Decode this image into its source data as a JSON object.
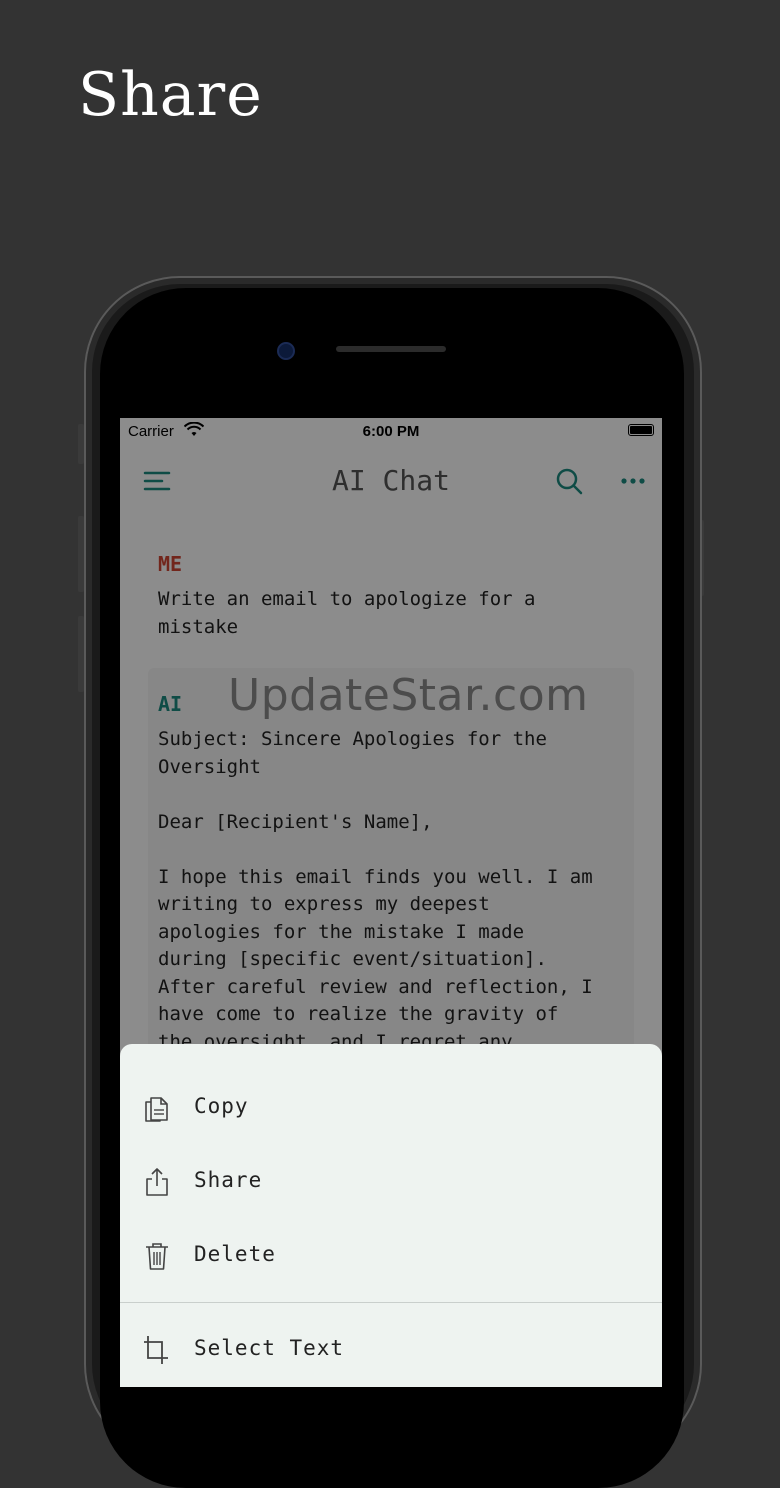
{
  "headline": "Share",
  "status": {
    "carrier": "Carrier",
    "time": "6:00 PM"
  },
  "nav": {
    "title": "AI Chat"
  },
  "watermark": "UpdateStar.com",
  "messages": {
    "me": {
      "sender": "ME",
      "text": "Write an email to apologize for a\nmistake"
    },
    "ai": {
      "sender": "AI",
      "text": "Subject: Sincere Apologies for the\nOversight\n\nDear [Recipient's Name],\n\nI hope this email finds you well. I am\nwriting to express my deepest\napologies for the mistake I made\nduring [specific event/situation].\nAfter careful review and reflection, I\nhave come to realize the gravity of\nthe oversight, and I regret any"
    }
  },
  "sheet": {
    "copy": "Copy",
    "share": "Share",
    "delete": "Delete",
    "select_text": "Select Text"
  },
  "colors": {
    "accent": "#1d8a80",
    "me_label": "#d04533",
    "background": "#333333",
    "sheet_bg": "#eef3f0"
  },
  "icons": [
    "menu-icon",
    "search-icon",
    "more-icon",
    "copy-icon",
    "share-icon",
    "trash-icon",
    "crop-icon"
  ]
}
